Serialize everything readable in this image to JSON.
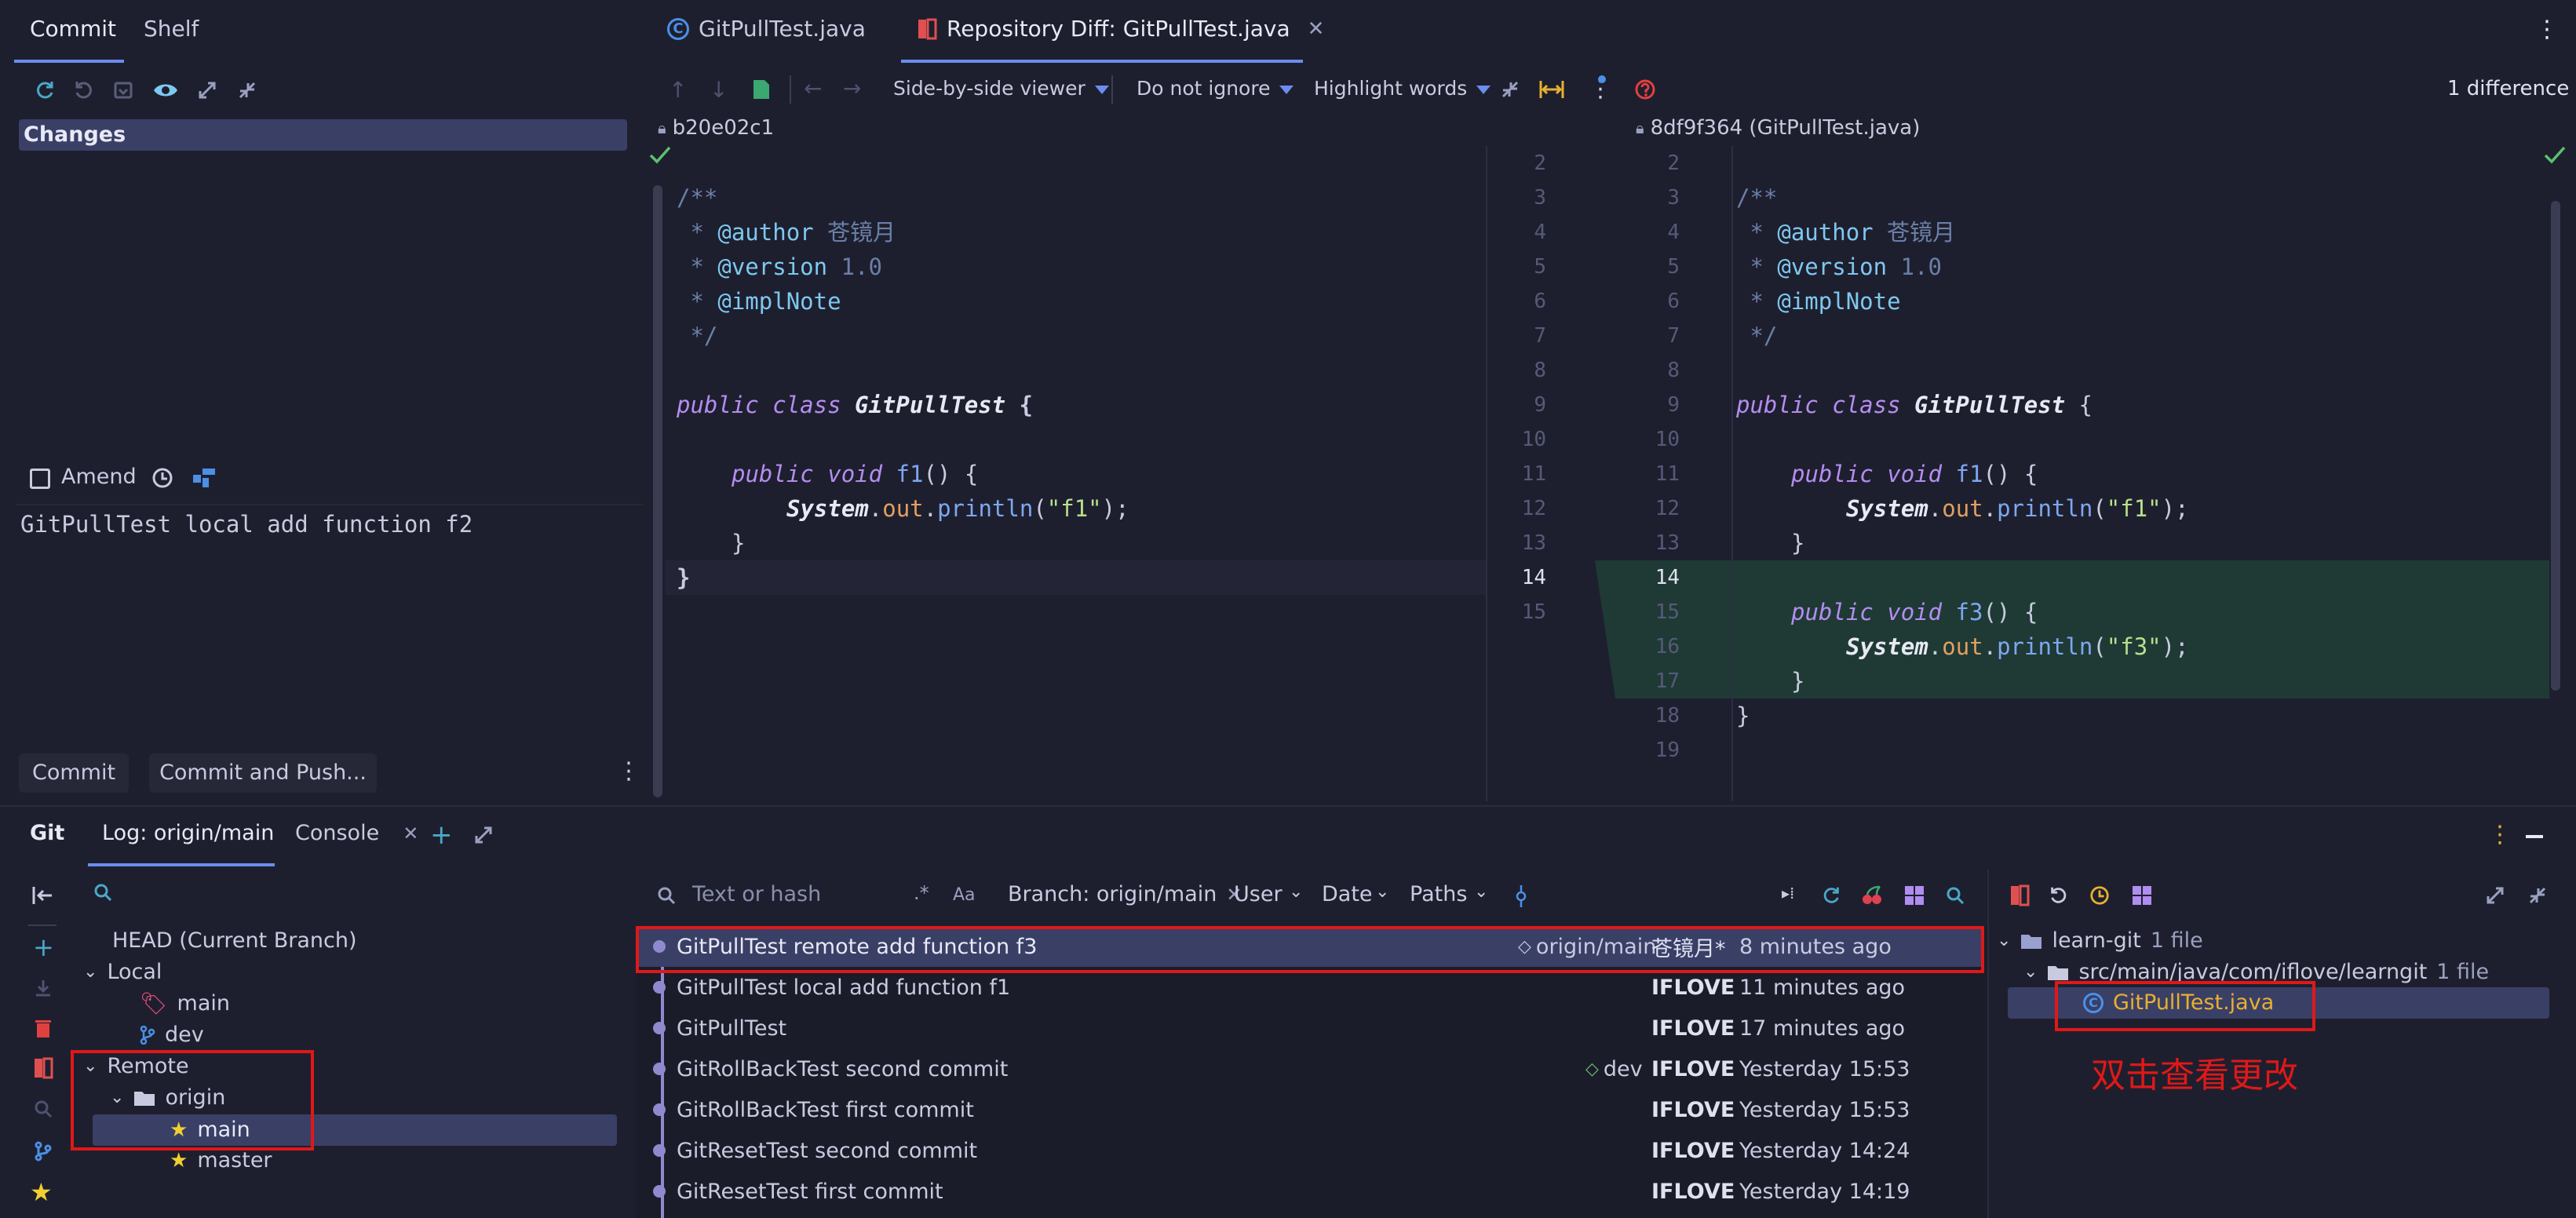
{
  "left_tabs": {
    "commit": "Commit",
    "shelf": "Shelf"
  },
  "editor_tabs": [
    {
      "label": "GitPullTest.java"
    },
    {
      "label": "Repository Diff: GitPullTest.java"
    }
  ],
  "diff_toolbar": {
    "viewer": "Side-by-side viewer",
    "ignore": "Do not ignore",
    "highlight": "Highlight words",
    "differences": "1 difference"
  },
  "changes": {
    "label": "Changes"
  },
  "amend": {
    "label": "Amend"
  },
  "commit_message": "GitPullTest local add function f2",
  "commit_buttons": {
    "commit": "Commit",
    "commit_push": "Commit and Push..."
  },
  "diff": {
    "left_rev": "b20e02c1",
    "right_rev": "8df9f364 (GitPullTest.java)",
    "left_gutter": [
      "2",
      "3",
      "4",
      "5",
      "6",
      "7",
      "8",
      "9",
      "10",
      "11",
      "12",
      "13",
      "14",
      "15"
    ],
    "right_gutter": [
      "2",
      "3",
      "4",
      "5",
      "6",
      "7",
      "8",
      "9",
      "10",
      "11",
      "12",
      "13",
      "14",
      "15",
      "16",
      "17",
      "18",
      "19"
    ],
    "code": {
      "doc_open": "/**",
      "star": " * ",
      "author_tag": "@author",
      "author_name": " 苍镜月",
      "version_tag": "@version",
      "version_val": " 1.0",
      "impl_tag": "@implNote",
      "doc_close": " */",
      "kw_public": "public",
      "kw_class": "class",
      "class_name": "GitPullTest",
      "kw_void": "void",
      "f1": "f1",
      "f3": "f3",
      "system": "System",
      "out": "out",
      "println": "println",
      "str_f1": "\"f1\"",
      "str_f3": "\"f3\"",
      "lbrace": "{",
      "rbrace": "}",
      "parens": "()",
      "dot": ".",
      "open_paren": "(",
      "close_semi": ");"
    }
  },
  "git_tabs": {
    "git": "Git",
    "log": "Log: origin/main",
    "console": "Console"
  },
  "branches": {
    "head": "HEAD (Current Branch)",
    "local": "Local",
    "local_items": [
      "main",
      "dev"
    ],
    "remote": "Remote",
    "origin": "origin",
    "remote_items": [
      "main",
      "master"
    ]
  },
  "log_filters": {
    "search_placeholder": "Text or hash",
    "case": "Aa",
    "branch": "Branch: origin/main",
    "user": "User",
    "date": "Date",
    "paths": "Paths"
  },
  "commits": [
    {
      "message": "GitPullTest remote add function f3",
      "ref": "origin/main",
      "author": "苍镜月*",
      "time": "8 minutes ago"
    },
    {
      "message": "GitPullTest local add function f1",
      "ref": "",
      "author": "IFLOVE",
      "time": "11 minutes ago"
    },
    {
      "message": "GitPullTest",
      "ref": "",
      "author": "IFLOVE",
      "time": "17 minutes ago"
    },
    {
      "message": "GitRollBackTest second commit",
      "ref": "dev",
      "author": "IFLOVE",
      "time": "Yesterday 15:53"
    },
    {
      "message": "GitRollBackTest first commit",
      "ref": "",
      "author": "IFLOVE",
      "time": "Yesterday 15:53"
    },
    {
      "message": "GitResetTest second commit",
      "ref": "",
      "author": "IFLOVE",
      "time": "Yesterday 14:24"
    },
    {
      "message": "GitResetTest first commit",
      "ref": "",
      "author": "IFLOVE",
      "time": "Yesterday 14:19"
    }
  ],
  "changed_files": {
    "root": "learn-git",
    "root_count": "1 file",
    "path": "src/main/java/com/iflove/learngit",
    "path_count": "1 file",
    "file": "GitPullTest.java"
  },
  "annotation": "双击查看更改",
  "colors": {
    "background": "#1e1f2e",
    "panel": "#1b1c29",
    "selected": "#3a3f66",
    "accent": "#6b8df0",
    "added": "#1f3a35",
    "annotation_red": "#e01818"
  }
}
